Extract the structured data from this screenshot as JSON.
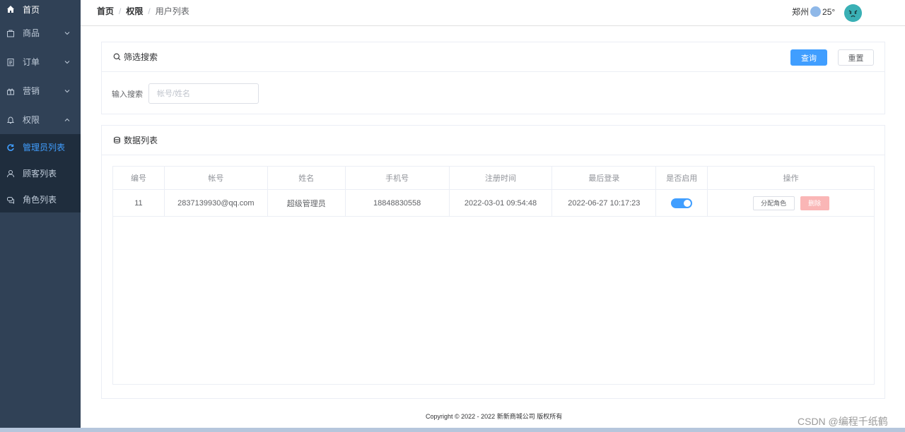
{
  "sidebar": {
    "items": [
      {
        "label": "首页"
      },
      {
        "label": "商品"
      },
      {
        "label": "订单"
      },
      {
        "label": "营销"
      },
      {
        "label": "权限"
      }
    ],
    "sub_items": [
      {
        "label": "管理员列表"
      },
      {
        "label": "顾客列表"
      },
      {
        "label": "角色列表"
      }
    ]
  },
  "header": {
    "breadcrumb": [
      "首页",
      "权限",
      "用户列表"
    ],
    "breadcrumb_sep": "/",
    "city": "郑州",
    "temperature": "25°"
  },
  "filter": {
    "title": "筛选搜索",
    "query_label": "查询",
    "reset_label": "重置",
    "search_label": "输入搜索",
    "search_placeholder": "帐号/姓名",
    "search_value": ""
  },
  "list": {
    "title": "数据列表",
    "columns": [
      "编号",
      "帐号",
      "姓名",
      "手机号",
      "注册时间",
      "最后登录",
      "是否启用",
      "操作"
    ],
    "rows": [
      {
        "id": "11",
        "account": "2837139930@qq.com",
        "name": "超级管理员",
        "phone": "18848830558",
        "registered": "2022-03-01 09:54:48",
        "last_login": "2022-06-27 10:17:23",
        "enabled": true,
        "assign_role_label": "分配角色",
        "delete_label": "删除"
      }
    ]
  },
  "footer": {
    "copyright": "Copyright © 2022 - 2022  新新商城公司 版权所有"
  },
  "watermark": "CSDN @编程千纸鹤",
  "colors": {
    "sidebar_bg": "#304156",
    "submenu_bg": "#1f2d3d",
    "primary": "#409eff",
    "danger_disabled": "#fab6b6"
  }
}
